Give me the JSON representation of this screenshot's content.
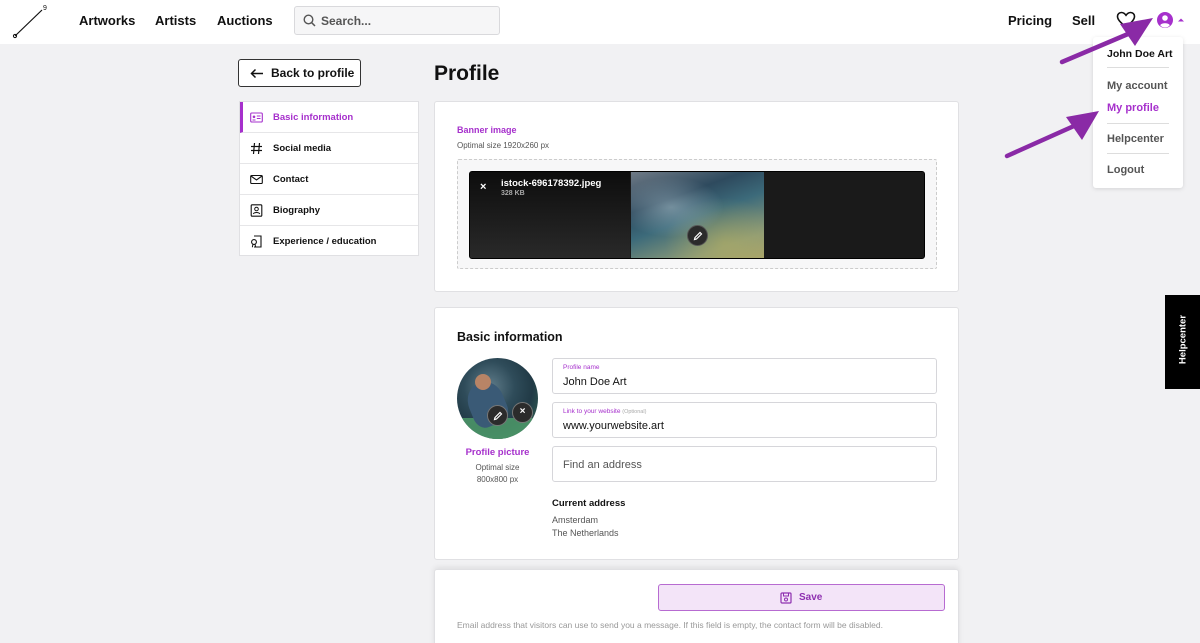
{
  "nav": {
    "links": [
      "Artworks",
      "Artists",
      "Auctions"
    ],
    "search_placeholder": "Search...",
    "pricing": "Pricing",
    "sell": "Sell"
  },
  "dropdown": {
    "user_name": "John Doe Art",
    "items": [
      "My account",
      "My profile",
      "Helpcenter",
      "Logout"
    ],
    "active_item": "My profile"
  },
  "back_button": "Back to profile",
  "page_title": "Profile",
  "sidebar": {
    "items": [
      {
        "label": "Basic information",
        "icon": "id-card-icon",
        "active": true
      },
      {
        "label": "Social media",
        "icon": "hashtag-icon",
        "active": false
      },
      {
        "label": "Contact",
        "icon": "envelope-icon",
        "active": false
      },
      {
        "label": "Biography",
        "icon": "portrait-icon",
        "active": false
      },
      {
        "label": "Experience / education",
        "icon": "certificate-icon",
        "active": false
      }
    ]
  },
  "banner": {
    "label": "Banner image",
    "hint": "Optimal size 1920x260 px",
    "file_name": "istock-696178392.jpeg",
    "file_size": "328 KB",
    "remove": "×"
  },
  "basic_info": {
    "title": "Basic information",
    "profile_picture_label": "Profile picture",
    "profile_picture_hint_1": "Optimal size",
    "profile_picture_hint_2": "800x800 px",
    "remove": "×",
    "profile_name_label": "Profile name",
    "profile_name_value": "John Doe Art",
    "website_label": "Link to your website",
    "website_optional": "(Optional)",
    "website_value": "www.yourwebsite.art",
    "address_placeholder": "Find an address",
    "current_address_label": "Current address",
    "address_line_1": "Amsterdam",
    "address_line_2": "The Netherlands"
  },
  "save_label": "Save",
  "contact_hint": "Email address that visitors can use to send you a message. If this field is empty, the contact form will be disabled.",
  "helpcenter_tab": "Helpcenter",
  "colors": {
    "accent": "#a630cc",
    "annotation_arrow": "#8a2aa6",
    "save_bg": "#f3e4f8"
  }
}
